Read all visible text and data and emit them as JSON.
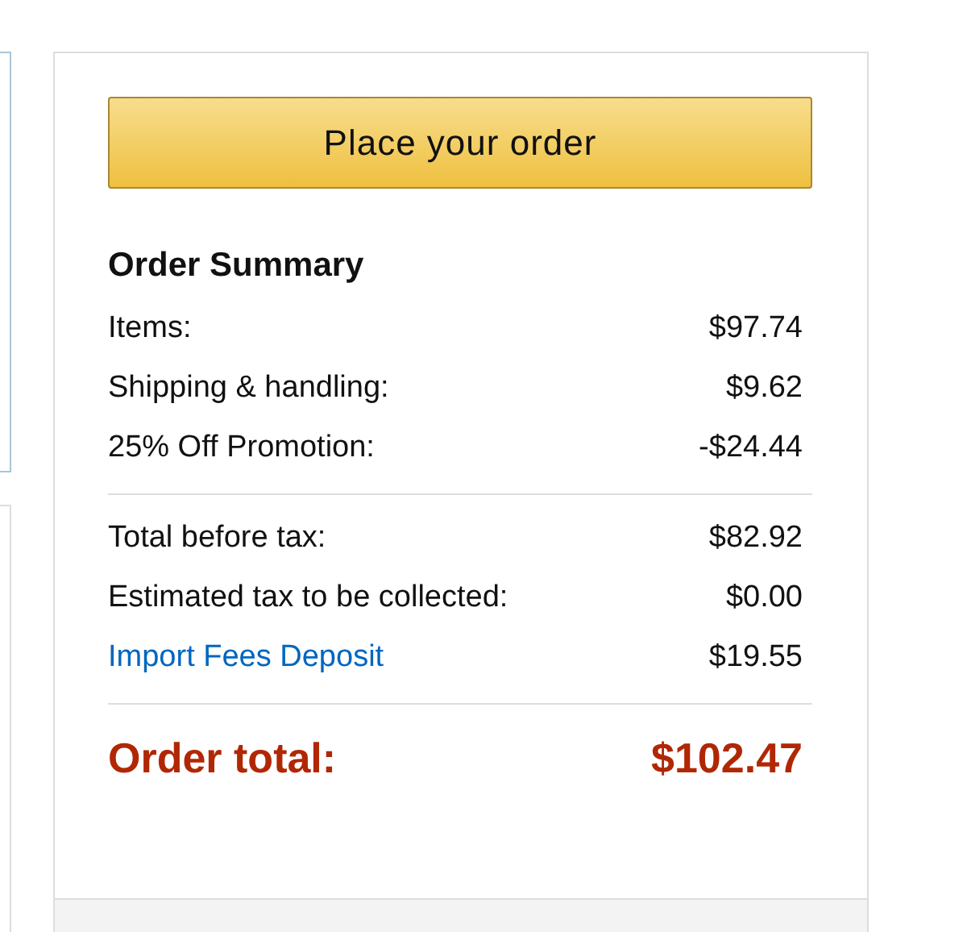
{
  "order_button": {
    "label": "Place your order"
  },
  "summary": {
    "title": "Order Summary",
    "groups": [
      [
        {
          "kind": "text",
          "label": "Items:",
          "amount": "$97.74"
        },
        {
          "kind": "text",
          "label": "Shipping & handling:",
          "amount": "$9.62"
        },
        {
          "kind": "text",
          "label": "25% Off Promotion:",
          "amount": "-$24.44"
        }
      ],
      [
        {
          "kind": "text",
          "label": "Total before tax:",
          "amount": "$82.92"
        },
        {
          "kind": "text",
          "label": "Estimated tax to be collected:",
          "amount": "$0.00"
        },
        {
          "kind": "link",
          "label": "Import Fees Deposit",
          "amount": "$19.55"
        }
      ]
    ],
    "total": {
      "label": "Order total:",
      "amount": "$102.47"
    }
  }
}
